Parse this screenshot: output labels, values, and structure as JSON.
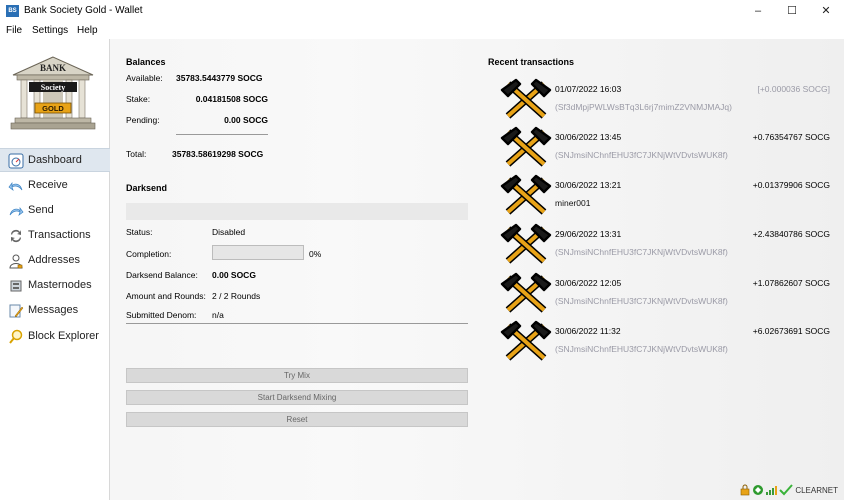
{
  "window": {
    "app_icon_text": "BS",
    "title": "Bank Society Gold - Wallet",
    "minimize": "–",
    "maximize": "☐",
    "close": "✕"
  },
  "menu": [
    "File",
    "Settings",
    "Help"
  ],
  "logo": {
    "line1": "BANK",
    "line2": "Society",
    "line3": "GOLD"
  },
  "sidebar": {
    "items": [
      {
        "label": "Dashboard",
        "icon": "dashboard-icon"
      },
      {
        "label": "Receive",
        "icon": "receive-arrow-icon"
      },
      {
        "label": "Send",
        "icon": "send-arrow-icon"
      },
      {
        "label": "Transactions",
        "icon": "transactions-icon"
      },
      {
        "label": "Addresses",
        "icon": "address-book-icon"
      },
      {
        "label": "Masternodes",
        "icon": "masternode-icon"
      },
      {
        "label": "Messages",
        "icon": "messages-icon"
      },
      {
        "label": "Block Explorer",
        "icon": "magnifier-icon"
      }
    ]
  },
  "balances": {
    "title": "Balances",
    "available_label": "Available:",
    "available_value": "35783.5443779 SOCG",
    "stake_label": "Stake:",
    "stake_value": "0.04181508 SOCG",
    "pending_label": "Pending:",
    "pending_value": "0.00 SOCG",
    "total_label": "Total:",
    "total_value": "35783.58619298 SOCG"
  },
  "darksend": {
    "title": "Darksend",
    "status_label": "Status:",
    "status_value": "Disabled",
    "completion_label": "Completion:",
    "completion_value": "0%",
    "completion_fraction": 0,
    "balance_label": "Darksend Balance:",
    "balance_value": "0.00 SOCG",
    "rounds_label": "Amount and Rounds:",
    "rounds_value": "2 / 2 Rounds",
    "denom_label": "Submitted Denom:",
    "denom_value": "n/a",
    "try_mix": "Try Mix",
    "start_mixing": "Start Darksend Mixing",
    "reset": "Reset"
  },
  "recent": {
    "title": "Recent transactions",
    "items": [
      {
        "date": "01/07/2022 16:03",
        "amount": "[+0.000036 SOCG]",
        "address": "(Sf3dMpjPWLWsBTq3L6rj7mimZ2VNMJMAJq)",
        "muted_amount": true,
        "dark_addr": false
      },
      {
        "date": "30/06/2022 13:45",
        "amount": "+0.76354767 SOCG",
        "address": "(SNJmsiNChnfEHU3fC7JKNjWtVDvtsWUK8f)",
        "muted_amount": false,
        "dark_addr": false
      },
      {
        "date": "30/06/2022 13:21",
        "amount": "+0.01379906 SOCG",
        "address": "miner001",
        "muted_amount": false,
        "dark_addr": true
      },
      {
        "date": "29/06/2022 13:31",
        "amount": "+2.43840786 SOCG",
        "address": "(SNJmsiNChnfEHU3fC7JKNjWtVDvtsWUK8f)",
        "muted_amount": false,
        "dark_addr": false
      },
      {
        "date": "30/06/2022 12:05",
        "amount": "+1.07862607 SOCG",
        "address": "(SNJmsiNChnfEHU3fC7JKNjWtVDvtsWUK8f)",
        "muted_amount": false,
        "dark_addr": false
      },
      {
        "date": "30/06/2022 11:32",
        "amount": "+6.02673691 SOCG",
        "address": "(SNJmsiNChnfEHU3fC7JKNjWtVDvtsWUK8f)",
        "muted_amount": false,
        "dark_addr": false
      }
    ]
  },
  "statusbar": {
    "network": "CLEARNET",
    "icons": [
      "lock-icon",
      "sync-ok-icon",
      "signal-bars-icon",
      "checkmark-icon"
    ]
  },
  "colors": {
    "accent": "#2a6fb5",
    "gold": "#e8a317",
    "muted_text": "#9a9aa6"
  }
}
